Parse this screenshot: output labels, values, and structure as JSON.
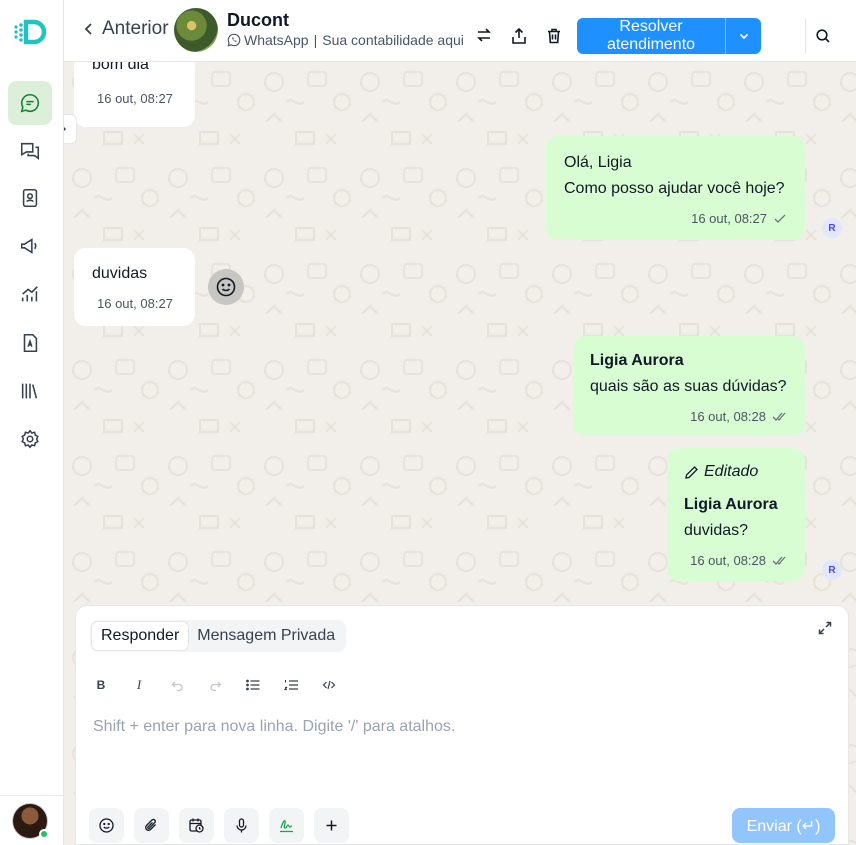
{
  "header": {
    "back_label": "Anterior",
    "contact_name": "Ducont",
    "channel": "WhatsApp",
    "separator": "|",
    "contact_subtitle": "Sua contabilidade aqui",
    "resolve_label": "Resolver atendimento"
  },
  "messages": [
    {
      "direction": "in",
      "text": "bom dia",
      "time": "16 out, 08:27"
    },
    {
      "direction": "out",
      "lines": [
        "Olá, Ligia",
        "Como posso ajudar você hoje?"
      ],
      "time": "16 out, 08:27",
      "status": "sent",
      "badge": "R"
    },
    {
      "direction": "in",
      "text": "duvidas",
      "time": "16 out, 08:27"
    },
    {
      "direction": "out",
      "author": "Ligia Aurora",
      "text": "quais são as suas dúvidas?",
      "time": "16 out, 08:28",
      "status": "delivered"
    },
    {
      "direction": "out",
      "edited": "Editado",
      "author": "Ligia Aurora",
      "text": "duvidas?",
      "time": "16 out, 08:28",
      "status": "delivered",
      "badge": "R"
    }
  ],
  "composer": {
    "tabs": [
      "Responder",
      "Mensagem Privada"
    ],
    "active_tab": "Responder",
    "toolbar": {
      "bold": "B",
      "italic": "I"
    },
    "placeholder": "Shift + enter para nova linha. Digite '/' para atalhos.",
    "send_label": "Enviar (↵)"
  },
  "icons": {
    "nav": [
      "chat-bubble-icon",
      "conversations-icon",
      "contacts-icon",
      "campaigns-icon",
      "reports-icon",
      "contact-card-icon",
      "library-icon",
      "settings-icon"
    ]
  },
  "colors": {
    "accent": "#1e90ff",
    "outgoing_bubble": "#d9fdd3",
    "chat_background": "#f2efea",
    "active_nav": "#dcefd9"
  }
}
